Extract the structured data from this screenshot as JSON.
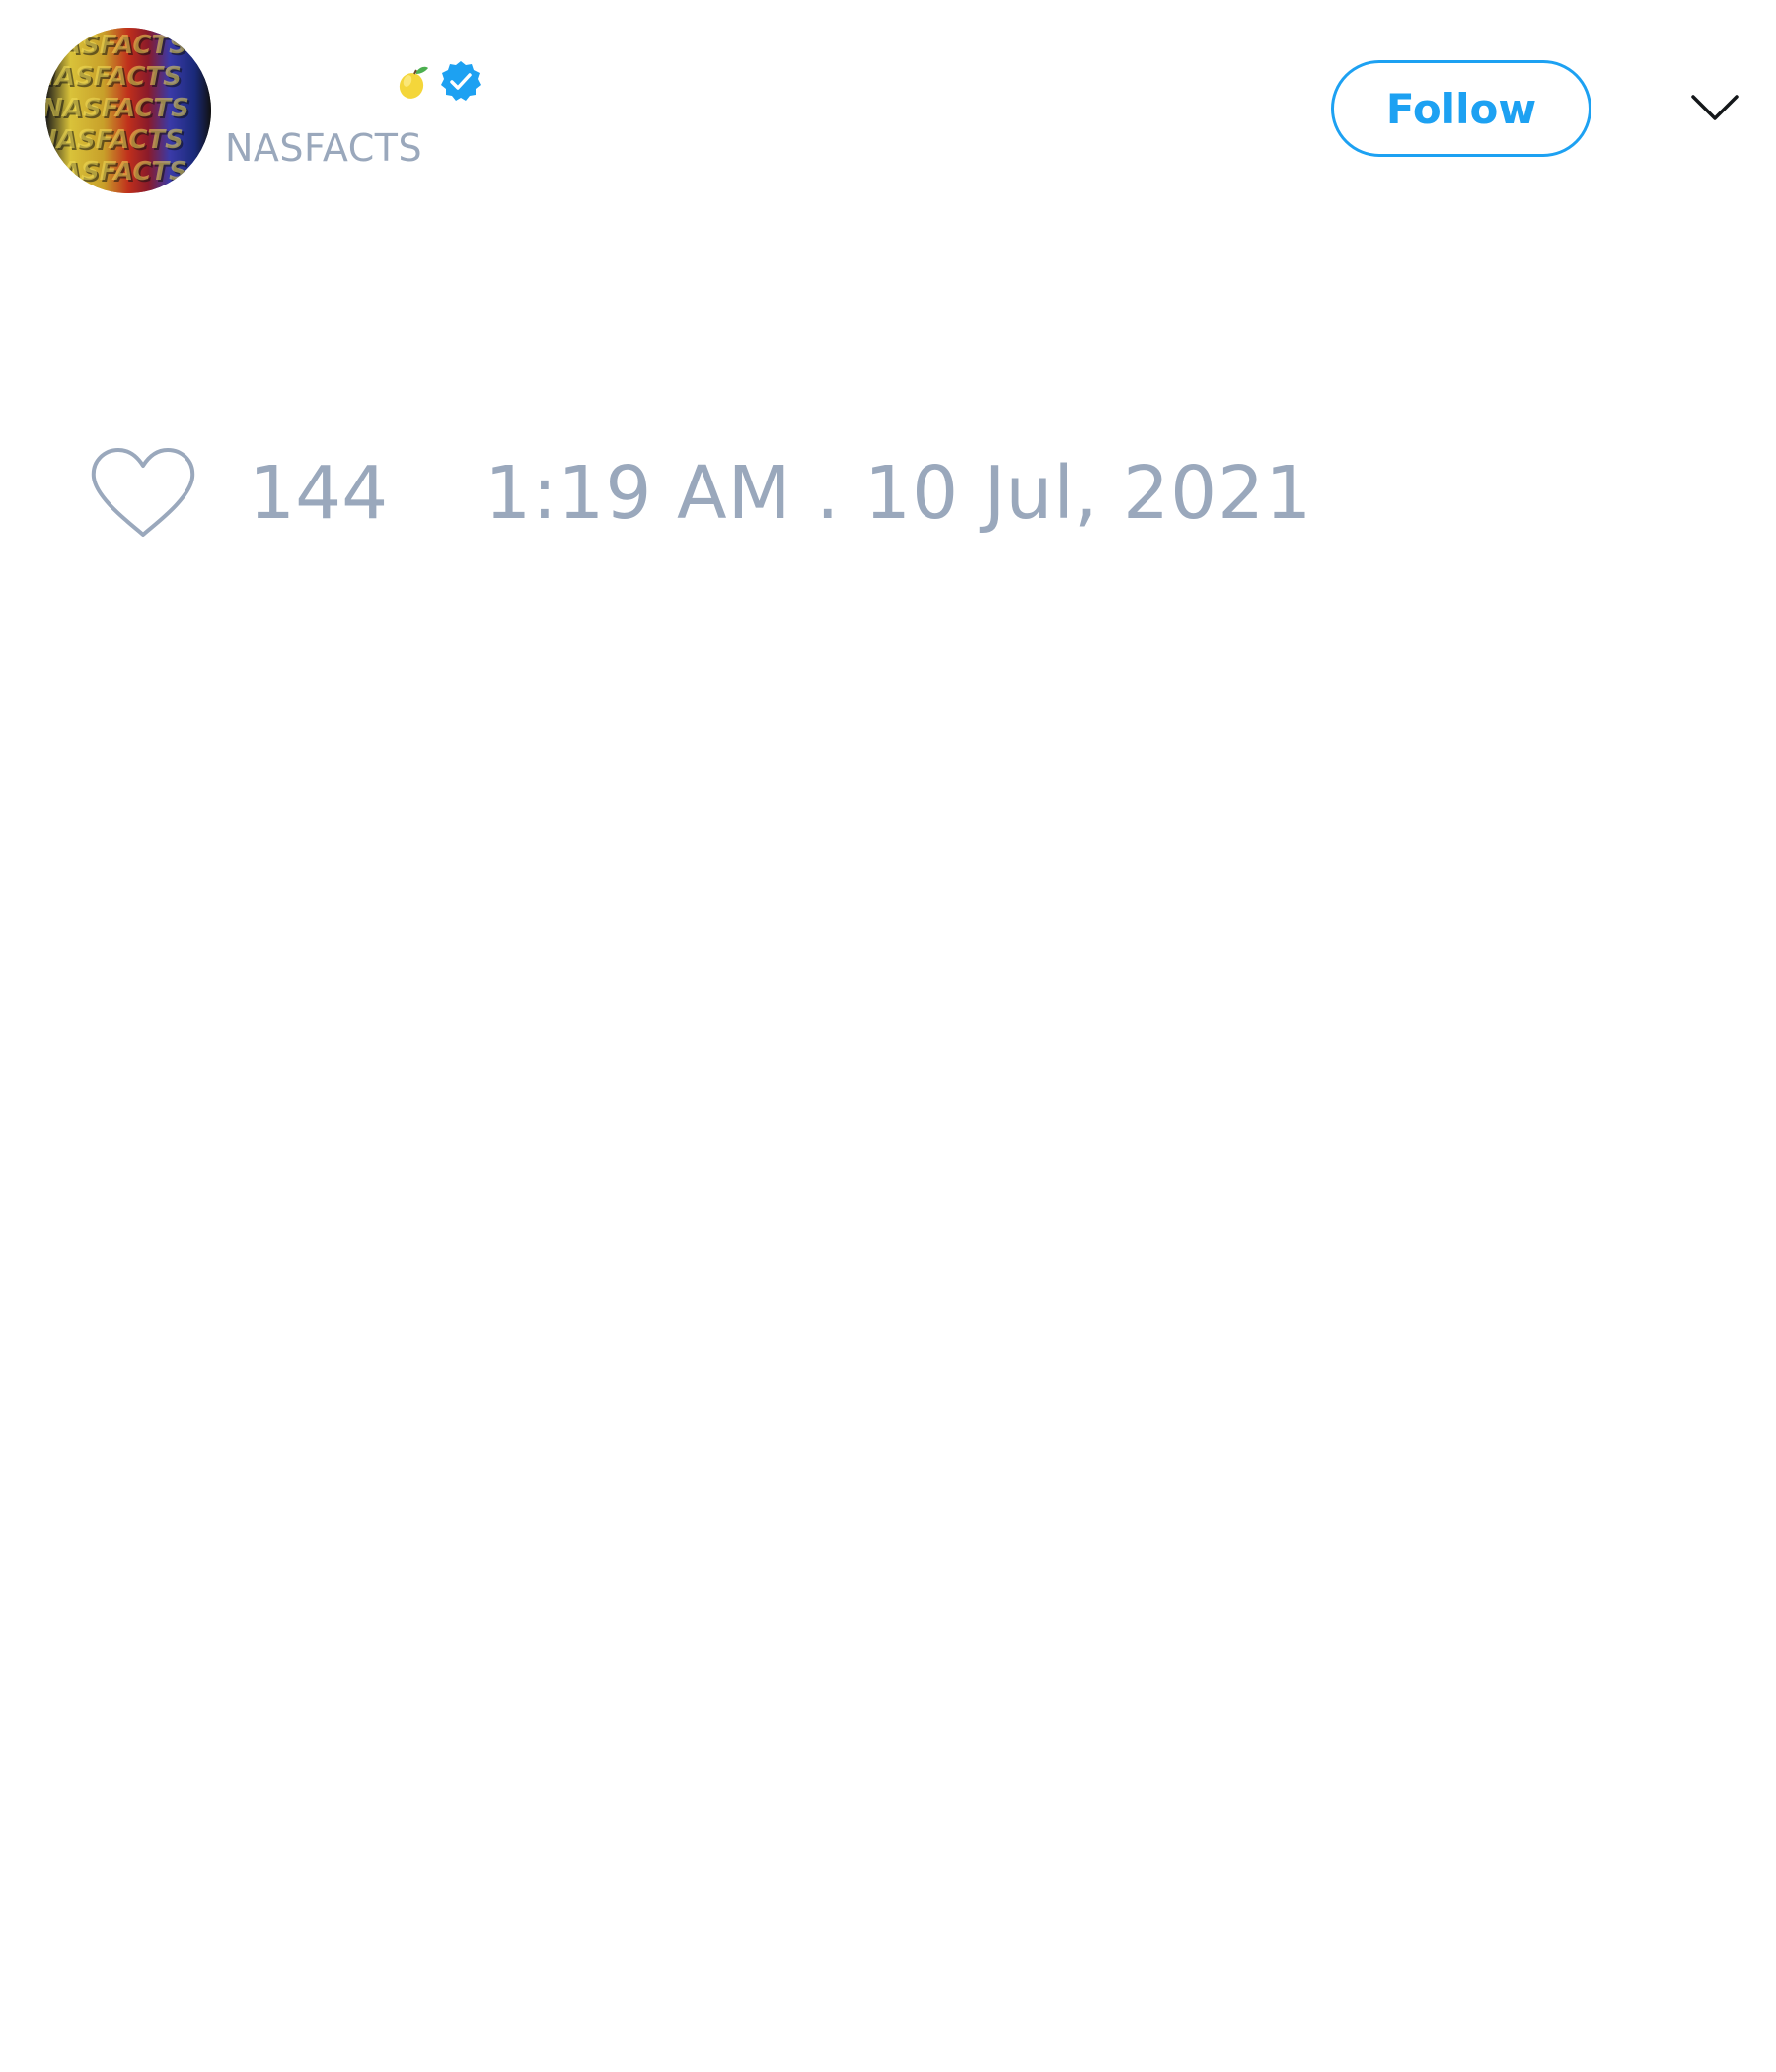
{
  "tweet": {
    "author": {
      "display_name": "",
      "handle": "NASFACTS",
      "avatar_icon": "avatar-nasfacts",
      "emoji_icon": "lemon-icon",
      "verified_icon": "verified-badge-icon"
    },
    "follow_label": "Follow",
    "menu_icon": "chevron-down-icon",
    "like_icon": "heart-icon",
    "like_count": "144",
    "timestamp": "1:19 AM . 10 Jul, 2021"
  },
  "colors": {
    "accent": "#1da1f2",
    "muted_text": "#9aa8bc",
    "verified": "#1da1f2",
    "lemon": "#f4d63a"
  }
}
